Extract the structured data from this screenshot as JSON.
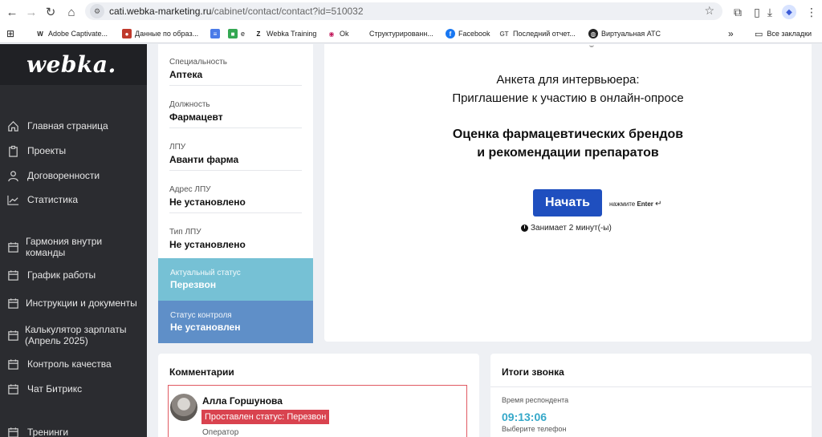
{
  "browser": {
    "url_host": "cati.webka-marketing.ru",
    "url_path": "/cabinet/contact/contact?id=510032",
    "bookmarks": [
      {
        "label": "Adobe Captivate...",
        "icon": "W"
      },
      {
        "label": "Данные по образ...",
        "icon": "●"
      },
      {
        "label": "",
        "icon": "≡"
      },
      {
        "label": "е",
        "icon": "■"
      },
      {
        "label": "Webka Training",
        "icon": "Z"
      },
      {
        "label": "Ok",
        "icon": "◉"
      },
      {
        "label": "Структурированн...",
        "icon": ""
      },
      {
        "label": "Facebook",
        "icon": "f"
      },
      {
        "label": "Последний отчет...",
        "icon": "GT"
      },
      {
        "label": "Виртуальная АТС",
        "icon": "◍"
      }
    ],
    "more": "»",
    "all_bookmarks": "Все закладки"
  },
  "sidebar": {
    "logo": "webka.",
    "items": [
      {
        "label": "Главная страница",
        "icon": "home-icon"
      },
      {
        "label": "Проекты",
        "icon": "clipboard-icon"
      },
      {
        "label": "Договоренности",
        "icon": "user-icon"
      },
      {
        "label": "Статистика",
        "icon": "chart-icon"
      },
      {
        "label": "Гармония внутри команды",
        "icon": "calendar-icon"
      },
      {
        "label": "График работы",
        "icon": "calendar-icon"
      },
      {
        "label": "Инструкции и документы",
        "icon": "calendar-icon"
      },
      {
        "label": "Калькулятор зарплаты (Апрель 2025)",
        "icon": "calendar-icon"
      },
      {
        "label": "Контроль качества",
        "icon": "calendar-icon"
      },
      {
        "label": "Чат Битрикс",
        "icon": "calendar-icon"
      },
      {
        "label": "Тренинги",
        "icon": "calendar-icon"
      }
    ]
  },
  "info": {
    "fields": [
      {
        "label": "Специальность",
        "value": "Аптека"
      },
      {
        "label": "Должность",
        "value": "Фармацевт"
      },
      {
        "label": "ЛПУ",
        "value": "Аванти фарма"
      },
      {
        "label": "Адрес ЛПУ",
        "value": "Не установлено"
      },
      {
        "label": "Тип ЛПУ",
        "value": "Не установлено"
      }
    ],
    "current_status": {
      "label": "Актуальный статус",
      "value": "Перезвон",
      "color": "#76c1d5"
    },
    "control_status": {
      "label": "Статус контроля",
      "value": "Не установлен",
      "color": "#5f8fc8"
    }
  },
  "survey": {
    "title_line1": "Анкета для интервьюера:",
    "title_line2": "Приглашение к участию в онлайн-опросе",
    "heading_line1": "Оценка фармацевтических брендов",
    "heading_line2": "и рекомендации препаратов",
    "start_label": "Начать",
    "enter_hint_prefix": "нажмите",
    "enter_key": "Enter",
    "enter_symbol": "↵",
    "duration": "Занимает 2 минут(-ы)",
    "accent": "#1f4fbf"
  },
  "comments": {
    "title": "Комментарии",
    "items": [
      {
        "author": "Алла Горшунова",
        "status": "Проставлен статус: Перезвон",
        "role": "Оператор"
      }
    ]
  },
  "results": {
    "title": "Итоги звонка",
    "respondent_time_label": "Время респондента",
    "respondent_time": "09:13:06",
    "phone_label": "Выберите телефон"
  }
}
